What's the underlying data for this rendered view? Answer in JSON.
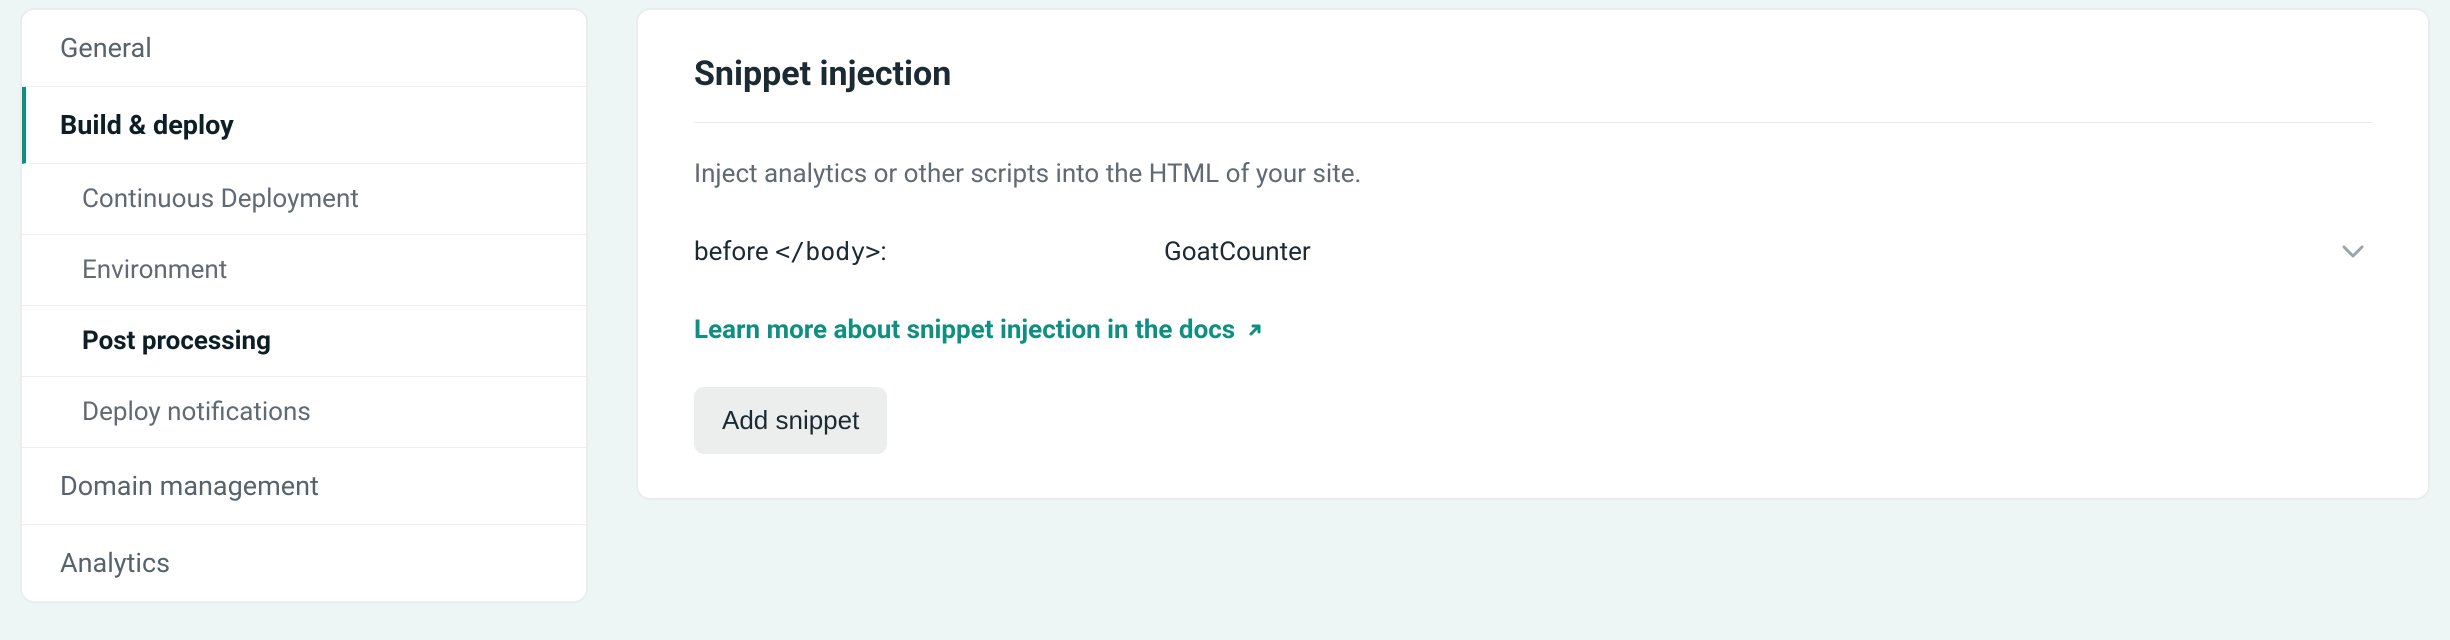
{
  "sidebar": {
    "general": "General",
    "build_deploy": "Build & deploy",
    "continuous_deployment": "Continuous Deployment",
    "environment": "Environment",
    "post_processing": "Post processing",
    "deploy_notifications": "Deploy notifications",
    "domain_management": "Domain management",
    "analytics": "Analytics"
  },
  "panel": {
    "title": "Snippet injection",
    "description": "Inject analytics or other scripts into the HTML of your site.",
    "snippet": {
      "position_label": "before ",
      "position_tag": "</body>",
      "position_suffix": ":",
      "name": "GoatCounter"
    },
    "docs_link": "Learn more about snippet injection in the docs",
    "add_button": "Add snippet"
  }
}
